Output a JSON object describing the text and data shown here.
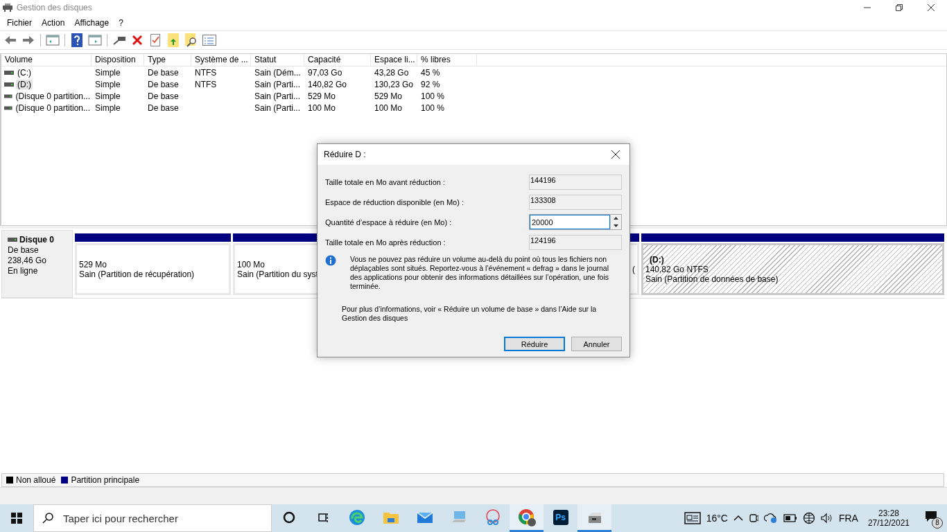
{
  "window": {
    "title": "Gestion des disques"
  },
  "menu": [
    "Fichier",
    "Action",
    "Affichage",
    "?"
  ],
  "table": {
    "columns": [
      "Volume",
      "Disposition",
      "Type",
      "Système de ...",
      "Statut",
      "Capacité",
      "Espace li...",
      "% libres"
    ],
    "rows": [
      {
        "selected": false,
        "cells": [
          "(C:)",
          "Simple",
          "De base",
          "NTFS",
          "Sain (Dém...",
          "97,03 Go",
          "43,28 Go",
          "45 %"
        ]
      },
      {
        "selected": true,
        "cells": [
          "(D:)",
          "Simple",
          "De base",
          "NTFS",
          "Sain (Parti...",
          "140,82 Go",
          "130,23 Go",
          "92 %"
        ]
      },
      {
        "selected": false,
        "cells": [
          "(Disque 0 partition...",
          "Simple",
          "De base",
          "",
          "Sain (Parti...",
          "529 Mo",
          "529 Mo",
          "100 %"
        ]
      },
      {
        "selected": false,
        "cells": [
          "(Disque 0 partition...",
          "Simple",
          "De base",
          "",
          "Sain (Parti...",
          "100 Mo",
          "100 Mo",
          "100 %"
        ]
      }
    ]
  },
  "disk": {
    "name": "Disque 0",
    "type": "De base",
    "size": "238,46 Go",
    "status": "En ligne",
    "partitions": [
      {
        "selected": false,
        "lines": [
          "529 Mo",
          "Sain (Partition de récupération)"
        ]
      },
      {
        "selected": false,
        "lines": [
          "100 Mo",
          "Sain (Partition du syst"
        ]
      },
      {
        "selected": false,
        "lines": [
          "("
        ]
      },
      {
        "selected": true,
        "label": "(D:)",
        "lines": [
          "140,82 Go NTFS",
          "Sain (Partition de données de base)"
        ]
      }
    ]
  },
  "legend": [
    {
      "label": "Non alloué",
      "color": "#000000"
    },
    {
      "label": "Partition principale",
      "color": "#000080"
    }
  ],
  "dialog": {
    "title": "Réduire D :",
    "fields": [
      {
        "kind": "readonly",
        "label": "Taille totale en Mo avant réduction :",
        "value": "144196"
      },
      {
        "kind": "readonly",
        "label": "Espace de réduction disponible (en Mo) :",
        "value": "133308"
      },
      {
        "kind": "spin",
        "label": "Quantité d’espace à réduire (en Mo) :",
        "value": "20000"
      },
      {
        "kind": "readonly",
        "label": "Taille totale en Mo après réduction :",
        "value": "124196"
      }
    ],
    "info": "Vous ne pouvez pas réduire un volume au-delà du point où tous les fichiers non déplaçables sont situés. Reportez-vous à l’événement « defrag » dans le journal des applications pour obtenir des informations détaillées sur l’opération, une fois terminée.",
    "more_info": "Pour plus d’informations, voir « Réduire un volume de base » dans l’Aide sur la Gestion des disques",
    "buttons": [
      {
        "label": "Réduire",
        "default": true
      },
      {
        "label": "Annuler",
        "default": false
      }
    ]
  },
  "taskbar": {
    "search": {
      "placeholder": "Taper ici pour rechercher"
    },
    "apps": [
      {
        "kind": "cortana",
        "running": false
      },
      {
        "kind": "taskview",
        "running": false
      },
      {
        "kind": "edge",
        "running": false
      },
      {
        "kind": "explorer",
        "running": false
      },
      {
        "kind": "mail",
        "running": false
      },
      {
        "kind": "computer",
        "running": false
      },
      {
        "kind": "snip",
        "running": false
      },
      {
        "kind": "chrome",
        "running": true
      },
      {
        "kind": "photoshop",
        "running": false,
        "text": "Ps"
      },
      {
        "kind": "diskmgmt",
        "running": true
      }
    ],
    "weather": "16°C",
    "language": "FRA",
    "time": "23:28",
    "date": "27/12/2021",
    "notifications": "8"
  }
}
